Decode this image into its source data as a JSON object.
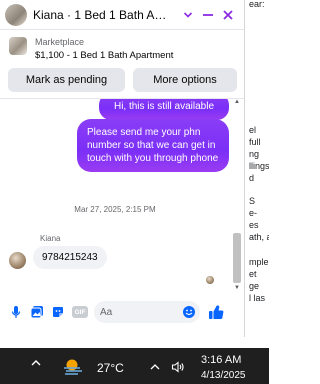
{
  "header": {
    "title": "Kiana · 1 Bed 1 Bath Apart...",
    "icons": [
      "chevron-down-icon",
      "minimize-icon",
      "close-icon"
    ],
    "accent_color": "#8a2be2"
  },
  "listing": {
    "source": "Marketplace",
    "price_line": "$1,100 - 1 Bed 1 Bath Apartment",
    "mark_pending_label": "Mark as pending",
    "more_options_label": "More options"
  },
  "messages": {
    "outgoing": [
      {
        "text": "Hi, this is still available"
      },
      {
        "text": "Please send me your phn number so that we can get in touch with you through phone"
      }
    ],
    "timestamp": "Mar 27, 2025, 2:15 PM",
    "incoming": {
      "sender": "Kiana",
      "text": "9784215243"
    },
    "bubble_color": "#7b2ff7"
  },
  "composer": {
    "placeholder": "Aa",
    "gif_label": "GIF",
    "icons": [
      "microphone-icon",
      "gallery-icon",
      "sticker-icon",
      "gif-icon",
      "emoji-icon",
      "thumbs-up-icon"
    ],
    "icon_color": "#0866ff"
  },
  "background_page": {
    "lines": [
      "ear:",
      "el",
      "full",
      "ng",
      "llings",
      "d",
      "S",
      "e-",
      "es",
      "ath, a",
      "mple",
      "et",
      "ge",
      "l las"
    ]
  },
  "taskbar": {
    "temperature": "27°C",
    "time": "3:16 AM",
    "date": "4/13/2025"
  }
}
